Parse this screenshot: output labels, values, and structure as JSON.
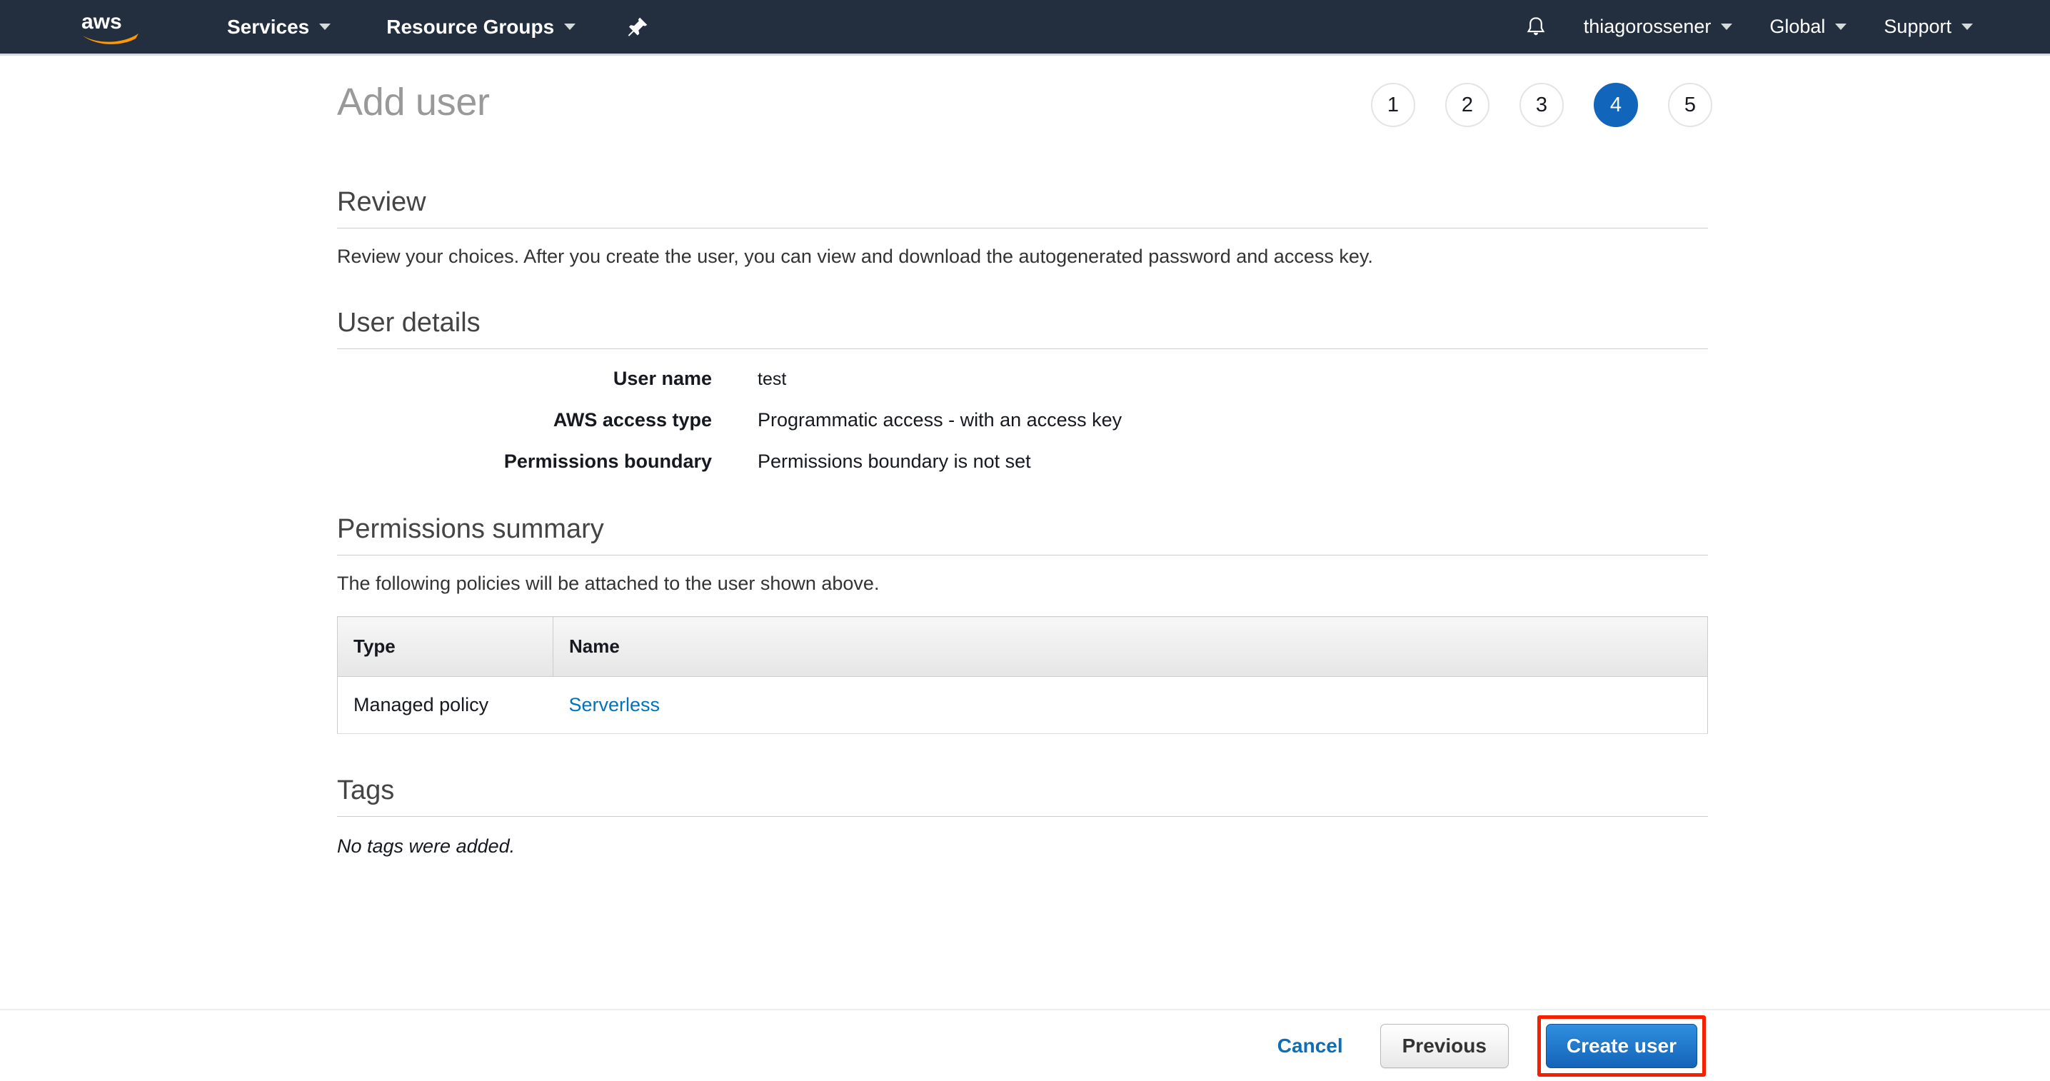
{
  "navbar": {
    "logo_alt": "aws",
    "left_items": [
      {
        "label": "Services",
        "icon": "chevron-down-icon"
      },
      {
        "label": "Resource Groups",
        "icon": "chevron-down-icon"
      }
    ],
    "pin_icon": "pushpin-icon",
    "bell_icon": "bell-icon",
    "right_items": [
      {
        "label": "thiagorossener",
        "icon": "chevron-down-icon"
      },
      {
        "label": "Global",
        "icon": "chevron-down-icon"
      },
      {
        "label": "Support",
        "icon": "chevron-down-icon"
      }
    ],
    "background_color": "#232f3e"
  },
  "header": {
    "title": "Add user",
    "steps": [
      "1",
      "2",
      "3",
      "4",
      "5"
    ],
    "active_step": "4",
    "active_color": "#1166bb"
  },
  "review": {
    "title": "Review",
    "description": "Review your choices. After you create the user, you can view and download the autogenerated password and access key."
  },
  "user_details": {
    "title": "User details",
    "rows": [
      {
        "label": "User name",
        "value": "test"
      },
      {
        "label": "AWS access type",
        "value": "Programmatic access - with an access key"
      },
      {
        "label": "Permissions boundary",
        "value": "Permissions boundary is not set"
      }
    ]
  },
  "permissions_summary": {
    "title": "Permissions summary",
    "description": "The following policies will be attached to the user shown above.",
    "columns": [
      "Type",
      "Name"
    ],
    "rows": [
      {
        "type": "Managed policy",
        "name": "Serverless",
        "name_is_link": true
      }
    ],
    "link_color": "#0073bb"
  },
  "tags": {
    "title": "Tags",
    "empty_text": "No tags were added."
  },
  "footer": {
    "cancel_label": "Cancel",
    "previous_label": "Previous",
    "create_label": "Create user",
    "highlight_color": "#f42000",
    "primary_color": "#1464b8"
  }
}
